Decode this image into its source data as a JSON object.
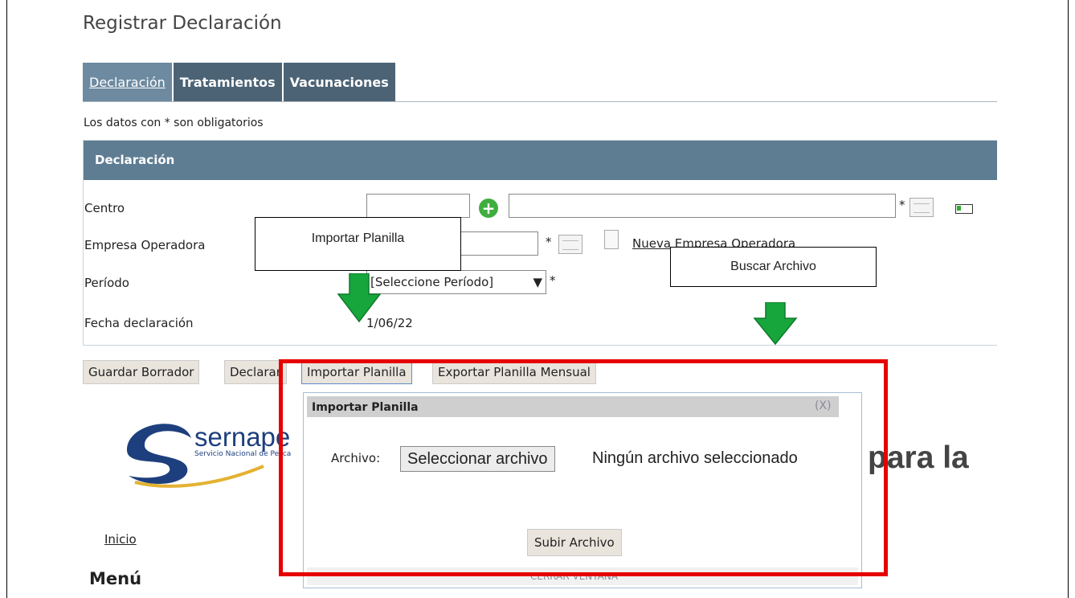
{
  "page": {
    "title": "Registrar Declaración"
  },
  "tabs": [
    {
      "label": "Declaración",
      "active": true
    },
    {
      "label": "Tratamientos",
      "active": false
    },
    {
      "label": "Vacunaciones",
      "active": false
    }
  ],
  "form": {
    "required_note": "Los datos con * son obligatorios",
    "section_title": "Declaración",
    "asterisk": "*",
    "centro": {
      "label": "Centro",
      "code": "",
      "name": ""
    },
    "empresa": {
      "label": "Empresa Operadora",
      "value": "",
      "link": "Nueva Empresa Operadora"
    },
    "periodo": {
      "label": "Período",
      "selected": "[Seleccione Período]",
      "caret": "▼"
    },
    "fecha": {
      "label": "Fecha declaración",
      "value": "1/06/22"
    }
  },
  "buttons": {
    "guardar": "Guardar Borrador",
    "declarar": "Declarar",
    "importar": "Importar Planilla",
    "exportar": "Exportar Planilla Mensual"
  },
  "background": {
    "logo_text": "sernape",
    "logo_sub": "Servicio Nacional de Pesca",
    "big_text": "para la",
    "inicio": "Inicio",
    "menu": "Menú"
  },
  "dialog": {
    "title": "Importar Planilla",
    "close": "(X)",
    "file_label": "Archivo:",
    "file_button": "Seleccionar archivo",
    "file_status": "Ningún archivo seleccionado",
    "upload_button": "Subir Archivo",
    "footer": "CERRAR VENTANA"
  },
  "annotations": {
    "callout_importar": "Importar Planilla",
    "callout_buscar": "Buscar Archivo",
    "highlight_color": "#e60000",
    "arrow_color": "#17a63c"
  }
}
